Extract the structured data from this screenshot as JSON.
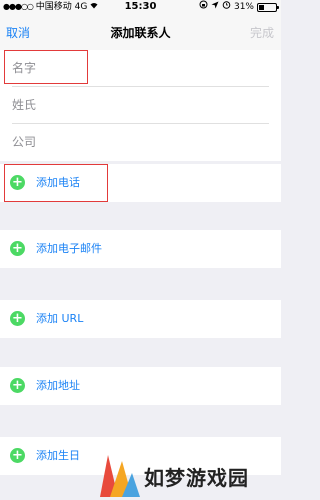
{
  "status": {
    "signal_dots": "●●●○○",
    "carrier": "中国移动",
    "network": "4G",
    "time": "15:30",
    "icons": [
      "orientation-lock-icon",
      "location-icon",
      "alarm-icon"
    ],
    "battery_text": "31%",
    "battery_level": 0.31
  },
  "nav": {
    "cancel_label": "取消",
    "title": "添加联系人",
    "done_label": "完成"
  },
  "name_fields": {
    "first_name_placeholder": "名字",
    "last_name_placeholder": "姓氏",
    "company_placeholder": "公司"
  },
  "add_rows": [
    {
      "label": "添加电话"
    },
    {
      "label": "添加电子邮件"
    },
    {
      "label": "添加 URL"
    },
    {
      "label": "添加地址"
    },
    {
      "label": "添加生日"
    }
  ],
  "watermark": {
    "text": "如梦游戏园"
  },
  "colors": {
    "accent": "#1a82f5",
    "add_icon": "#4cd964",
    "highlight_box": "#e23a3a",
    "background": "#efeff4"
  }
}
